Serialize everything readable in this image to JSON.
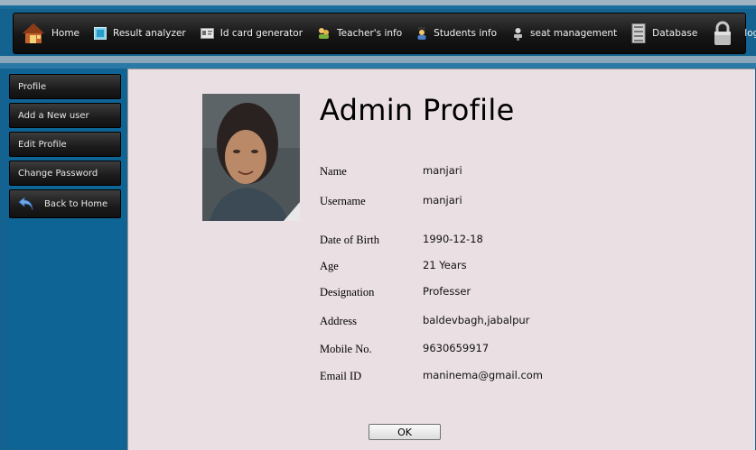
{
  "nav": {
    "items": [
      {
        "label": "Home",
        "icon": "house-icon"
      },
      {
        "label": "Result analyzer",
        "icon": "monitor-icon"
      },
      {
        "label": "Id card generator",
        "icon": "id-card-icon"
      },
      {
        "label": "Teacher's info",
        "icon": "teacher-icon"
      },
      {
        "label": "Students info",
        "icon": "student-icon"
      },
      {
        "label": "seat management",
        "icon": "seat-icon"
      },
      {
        "label": "Database",
        "icon": "database-icon"
      },
      {
        "label": "logout",
        "icon": "padlock-icon"
      }
    ]
  },
  "sidebar": {
    "items": [
      {
        "label": "Profile"
      },
      {
        "label": "Add a New user"
      },
      {
        "label": "Edit Profile"
      },
      {
        "label": "Change Password"
      },
      {
        "label": "Back to Home",
        "icon": "back-arrow-icon"
      }
    ]
  },
  "profile": {
    "title": "Admin Profile",
    "fields": [
      {
        "label": "Name",
        "value": "manjari"
      },
      {
        "label": "Username",
        "value": "manjari"
      },
      {
        "label": "Date of Birth",
        "value": "1990-12-18"
      },
      {
        "label": "Age",
        "value": "21 Years"
      },
      {
        "label": "Designation",
        "value": "Professer"
      },
      {
        "label": "Address",
        "value": "baldevbagh,jabalpur"
      },
      {
        "label": "Mobile No.",
        "value": "9630659917"
      },
      {
        "label": "Email ID",
        "value": "maninema@gmail.com"
      }
    ],
    "ok_label": "OK"
  },
  "colors": {
    "page_bg": "#14628f",
    "content_bg": "#eadfe3",
    "nav_bg": "#161616"
  }
}
